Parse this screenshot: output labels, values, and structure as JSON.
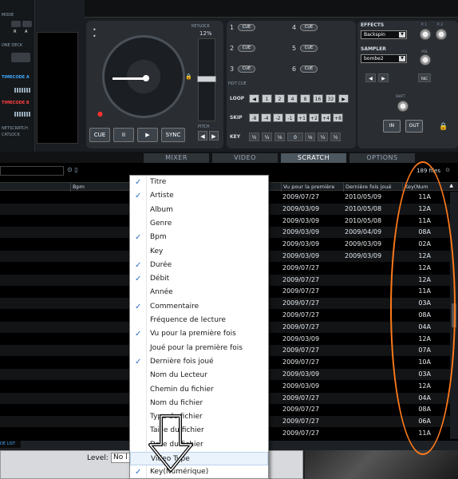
{
  "left_strip": {
    "mode_label": "MODE",
    "one_deck_label": "ONE DECK",
    "timecode_a": "TIMECODE A",
    "timecode_b": "TIMECODE B",
    "netscratch": "NETSCRATCH",
    "catlock": "CATLOCK",
    "btn_r": "R",
    "btn_a": "A"
  },
  "deck": {
    "keylock_label": "KEYLOCK",
    "keylock_value": "12%",
    "pitch_label": "PITCH",
    "transport": {
      "cue": "CUE",
      "pause": "II",
      "play": "▶",
      "sync": "SYNC"
    }
  },
  "cues": {
    "numbers": [
      "1",
      "2",
      "3",
      "4",
      "5",
      "6"
    ],
    "button_label": "CUE",
    "hot_cue_label": "HOT CUE",
    "loop_label": "LOOP",
    "loop_values": [
      "1",
      "2",
      "4",
      "8",
      "16",
      "32"
    ],
    "skip_label": "SKIP",
    "skip_values": [
      "-8",
      "-4",
      "-2",
      "-1",
      "+1",
      "+2",
      "+4",
      "+8"
    ],
    "key_label": "KEY",
    "key_values": [
      "½",
      "¼",
      "⅛",
      "0",
      "⅛",
      "¼",
      "½"
    ]
  },
  "fx": {
    "effects_label": "EFFECTS",
    "effects_value": "Backspin",
    "p1": "P. 1",
    "p2": "P. 2",
    "sampler_label": "SAMPLER",
    "sampler_value": "bombe2",
    "vol": "VOL",
    "rec": "REC",
    "shift": "SHIFT",
    "in": "IN",
    "out": "OUT"
  },
  "tabs": [
    "MIXER",
    "VIDEO",
    "SCRATCH",
    "OPTIONS"
  ],
  "active_tab": "SCRATCH",
  "browser": {
    "files_count": "189 files",
    "columns": {
      "bpm": "Bpm",
      "first_seen": "Vu pour la première",
      "last_played": "Dernière fois joué",
      "key": "Key(Num"
    },
    "rows": [
      {
        "first": "2009/07/27",
        "last": "2010/05/09",
        "key": "11A"
      },
      {
        "first": "2009/03/09",
        "last": "2010/05/08",
        "key": "12A"
      },
      {
        "first": "2009/03/09",
        "last": "2010/05/08",
        "key": "11A"
      },
      {
        "first": "2009/03/09",
        "last": "2009/04/09",
        "key": "08A"
      },
      {
        "first": "2009/03/09",
        "last": "2009/03/09",
        "key": "02A"
      },
      {
        "first": "2009/03/09",
        "last": "2009/03/09",
        "key": "12A"
      },
      {
        "first": "2009/07/27",
        "last": "",
        "key": "12A"
      },
      {
        "first": "2009/07/27",
        "last": "",
        "key": "12A"
      },
      {
        "first": "2009/07/27",
        "last": "",
        "key": "11A"
      },
      {
        "first": "2009/07/27",
        "last": "",
        "key": "03A"
      },
      {
        "first": "2009/07/27",
        "last": "",
        "key": "08A"
      },
      {
        "first": "2009/07/27",
        "last": "",
        "key": "04A"
      },
      {
        "first": "2009/03/09",
        "last": "",
        "key": "12A"
      },
      {
        "first": "2009/07/27",
        "last": "",
        "key": "07A"
      },
      {
        "first": "2009/07/27",
        "last": "",
        "key": "10A"
      },
      {
        "first": "2009/03/09",
        "last": "",
        "key": "03A"
      },
      {
        "first": "2009/03/09",
        "last": "",
        "key": "12A"
      },
      {
        "first": "2009/07/27",
        "last": "",
        "key": "04A"
      },
      {
        "first": "2009/07/27",
        "last": "",
        "key": "08A"
      },
      {
        "first": "2009/07/27",
        "last": "",
        "key": "06A"
      },
      {
        "first": "2009/07/27",
        "last": "",
        "key": "11A"
      }
    ]
  },
  "bottom": {
    "list_label": "DE LIST",
    "level_label": "Level:",
    "level_value": "No l"
  },
  "context_menu": {
    "items": [
      {
        "label": "Titre",
        "checked": true
      },
      {
        "label": "Artiste",
        "checked": true
      },
      {
        "label": "Album",
        "checked": false
      },
      {
        "label": "Genre",
        "checked": false
      },
      {
        "label": "Bpm",
        "checked": true
      },
      {
        "label": "Key",
        "checked": false
      },
      {
        "label": "Durée",
        "checked": true
      },
      {
        "label": "Débit",
        "checked": true
      },
      {
        "label": "Année",
        "checked": false
      },
      {
        "label": "Commentaire",
        "checked": true
      },
      {
        "label": "Fréquence de lecture",
        "checked": false
      },
      {
        "label": "Vu pour la première fois",
        "checked": true
      },
      {
        "label": "Joué pour la première fois",
        "checked": false
      },
      {
        "label": "Dernière fois joué",
        "checked": true
      },
      {
        "label": "Nom du Lecteur",
        "checked": false
      },
      {
        "label": "Chemin du fichier",
        "checked": false
      },
      {
        "label": "Nom du fichier",
        "checked": false
      },
      {
        "label": "Type de fichier",
        "checked": false
      },
      {
        "label": "Taille du fichier",
        "checked": false
      },
      {
        "label": "Date du fichier",
        "checked": false
      },
      {
        "label": "Video Type",
        "checked": false
      },
      {
        "label": "Key(Numérique)",
        "checked": true
      }
    ],
    "check_glyph": "✓",
    "hovered_index": 20
  },
  "colors": {
    "annotation_orange": "#ff7a1a",
    "check_blue": "#2a6fc9",
    "timecode_blue": "#3fa9ff",
    "timecode_red": "#ff4040",
    "lock_orange": "#e6a020"
  }
}
